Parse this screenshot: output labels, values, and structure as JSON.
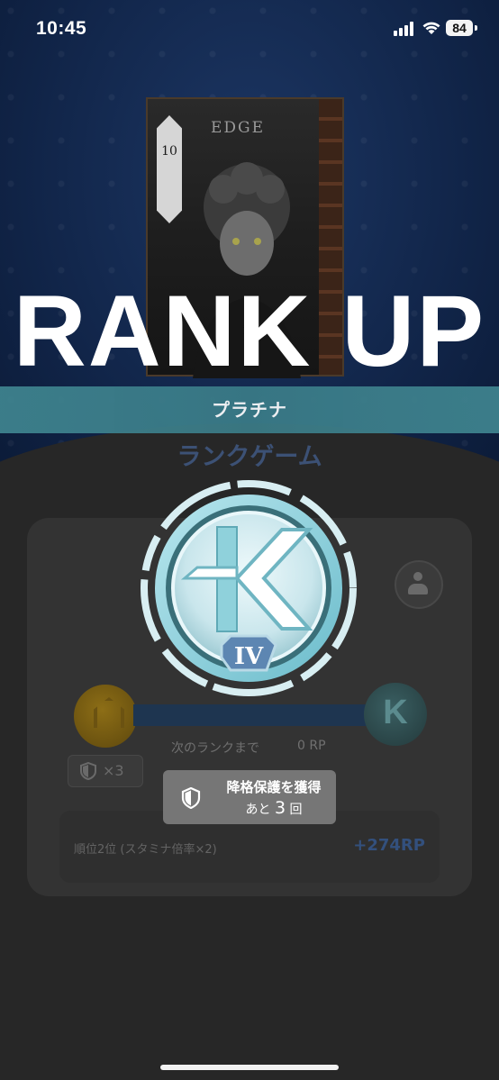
{
  "status_bar": {
    "time": "10:45",
    "battery": "84"
  },
  "card": {
    "title": "EDGE",
    "badge_number": "10",
    "badge_suit": "♦"
  },
  "rank_up": {
    "title": "RANK UP",
    "tier": "プラチナ",
    "tier_level": "IV"
  },
  "rank_game": {
    "heading": "ランクゲーム",
    "next_rank_label": "次のランクまで",
    "next_rank_value": "0 RP",
    "demotion_shield_count": "×3",
    "result_label": "順位2位 (スタミナ倍率×2)",
    "result_value": "+274RP"
  },
  "toast": {
    "line1": "降格保護を獲得",
    "line2_prefix": "あと",
    "line2_count": "3",
    "line2_suffix": "回"
  },
  "colors": {
    "banner": "#3f8590",
    "emblem_light": "#d9f1f5",
    "emblem_accent": "#8ed2dc",
    "background_blue": "#112549"
  },
  "icons": [
    "cellular-signal-icon",
    "wifi-icon",
    "battery-icon",
    "shield-icon",
    "profile-icon"
  ]
}
